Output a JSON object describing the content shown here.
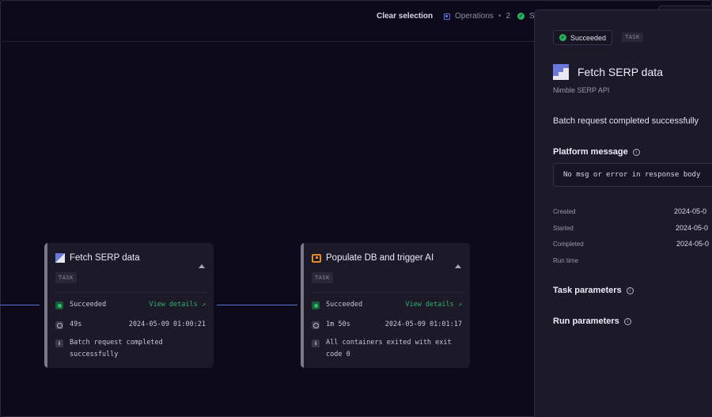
{
  "topbar": {
    "clear_selection": "Clear selection",
    "operations_label": "Operations",
    "operations_sep": "•",
    "operations_count": "2",
    "status_label": "S"
  },
  "nodes": [
    {
      "title": "Fetch SERP data",
      "tag": "TASK",
      "status": "Succeeded",
      "view_details": "View details ↗",
      "duration": "49s",
      "timestamp": "2024-05-09 01:00:21",
      "message": "Batch request completed successfully",
      "icon": "serp-logo-icon"
    },
    {
      "title": "Populate DB and trigger AI",
      "tag": "TASK",
      "status": "Succeeded",
      "view_details": "View details ↗",
      "duration": "1m 50s",
      "timestamp": "2024-05-09 01:01:17",
      "message": "All containers exited with exit code 0",
      "icon": "database-logo-icon"
    }
  ],
  "panel": {
    "status": "Succeeded",
    "tag": "TASK",
    "title": "Fetch SERP data",
    "subtitle": "Nimble SERP API",
    "message": "Batch request completed successfully",
    "platform_message_heading": "Platform message",
    "platform_message": "No msg or error in response body",
    "meta": {
      "created_label": "Created",
      "created_value": "2024-05-0",
      "started_label": "Started",
      "started_value": "2024-05-0",
      "completed_label": "Completed",
      "completed_value": "2024-05-0",
      "runtime_label": "Run time"
    },
    "task_parameters": "Task parameters",
    "run_parameters": "Run parameters"
  },
  "colors": {
    "background": "#0d0a1b",
    "success": "#22b35e",
    "edge": "#5b72cf",
    "accent_orange": "#e58a27"
  }
}
